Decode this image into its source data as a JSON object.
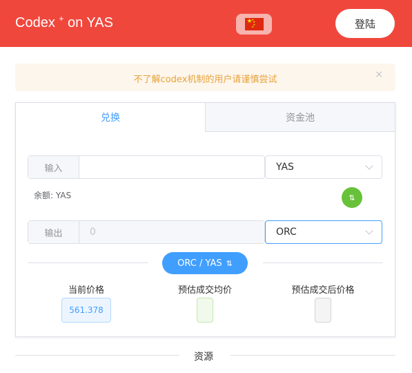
{
  "header": {
    "title": "Codex",
    "title_sup": "+",
    "title_suffix": "on YAS",
    "language_flag_icon": "china-flag-icon",
    "login_label": "登陆",
    "color": "#f0473d"
  },
  "notice": {
    "text": "不了解codex机制的用户请谨慎尝试",
    "close_glyph": "×"
  },
  "tabs": [
    {
      "label": "兑换",
      "active": true
    },
    {
      "label": "资金池",
      "active": false
    }
  ],
  "swap": {
    "input_label": "输入",
    "input_value": "",
    "input_token": "YAS",
    "balance": "余额: YAS",
    "output_label": "输出",
    "output_placeholder": "0",
    "output_token": "ORC",
    "swap_icon": "swap-vertical-icon",
    "pair_label": "ORC / YAS",
    "pair_icon": "swap-icon"
  },
  "stats": {
    "current_price_label": "当前价格",
    "current_price_value": "561.378",
    "avg_price_label": "预估成交均价",
    "avg_price_value": "",
    "after_price_label": "预估成交后价格",
    "after_price_value": ""
  },
  "footer": {
    "section_title": "资源"
  }
}
